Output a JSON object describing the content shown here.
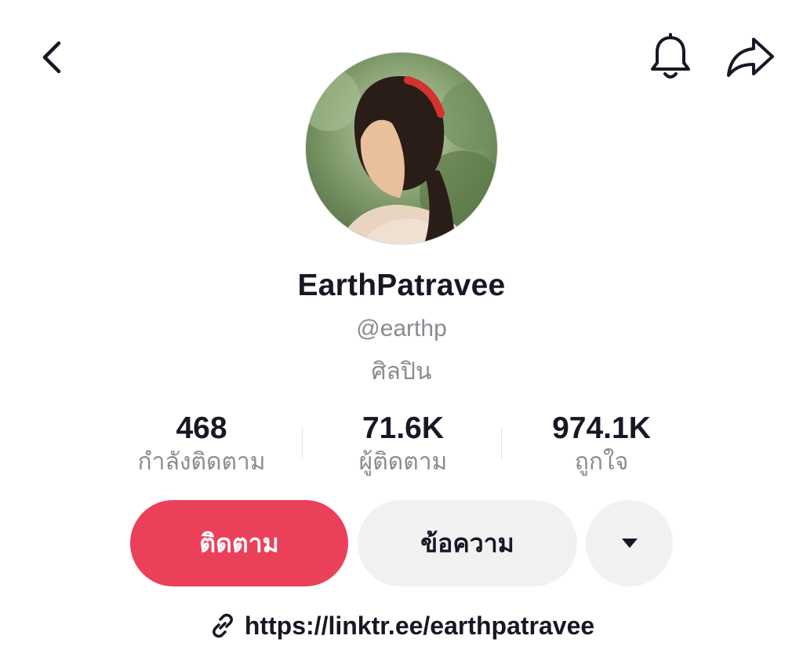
{
  "header": {
    "back_icon": "chevron-left-icon",
    "bell_icon": "bell-icon",
    "share_icon": "share-arrow-icon"
  },
  "profile": {
    "display_name": "EarthPatravee",
    "handle": "@earthp",
    "category": "ศิลปิน"
  },
  "stats": {
    "following": {
      "value": "468",
      "label": "กำลังติดตาม"
    },
    "followers": {
      "value": "71.6K",
      "label": "ผู้ติดตาม"
    },
    "likes": {
      "value": "974.1K",
      "label": "ถูกใจ"
    }
  },
  "actions": {
    "follow_label": "ติดตาม",
    "message_label": "ข้อความ",
    "more_icon": "caret-down-icon"
  },
  "link": {
    "icon": "link-icon",
    "url": "https://linktr.ee/earthpatravee"
  },
  "colors": {
    "accent": "#ea405a",
    "text_primary": "#161823",
    "text_secondary": "#8a8b91",
    "button_secondary": "#f1f1f2"
  }
}
